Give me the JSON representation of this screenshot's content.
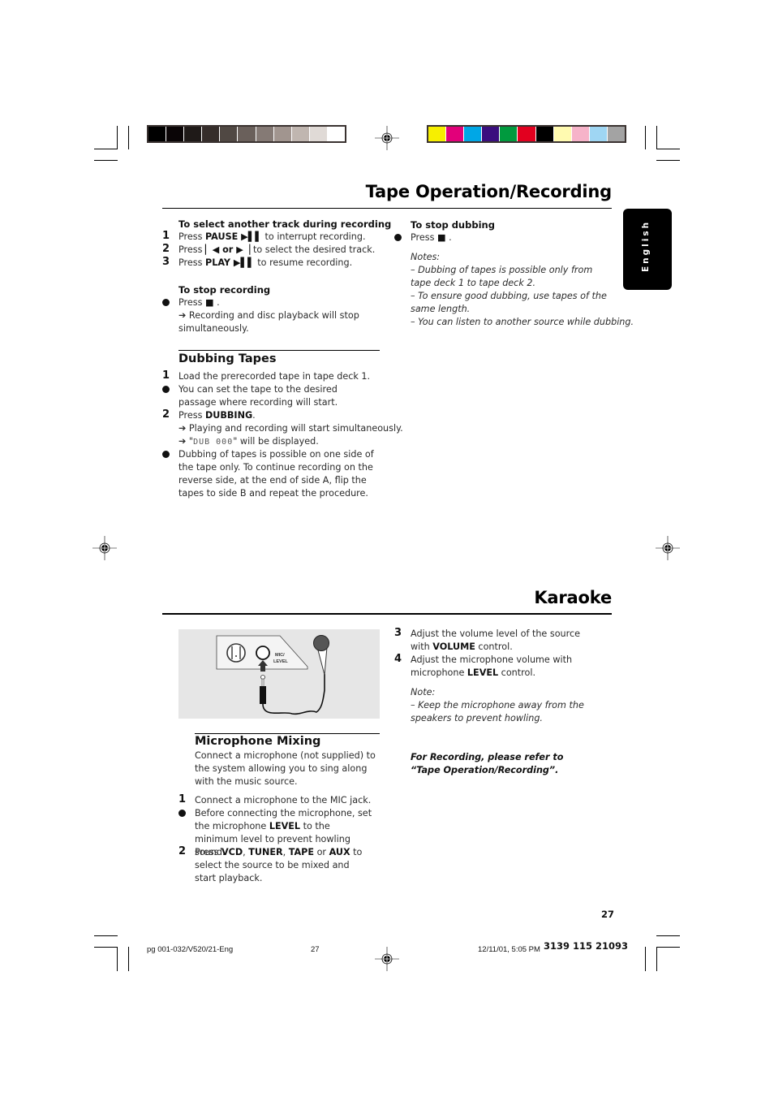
{
  "calibration": {
    "grayscale": [
      "#000000",
      "#0a0506",
      "#1f1a18",
      "#352d2a",
      "#504843",
      "#6a605b",
      "#857a75",
      "#a1958f",
      "#c0b6b0",
      "#e0dad6",
      "#ffffff"
    ],
    "color": [
      "#f7ef00",
      "#e2007a",
      "#00a7e6",
      "#3a0e7e",
      "#009a3e",
      "#e2001f",
      "#000000",
      "#fffab0",
      "#f6b3c9",
      "#9fd6f3",
      "#a3a3a3"
    ]
  },
  "language_tab": "English",
  "section1": {
    "title": "Tape Operation/Recording",
    "select_track": {
      "heading": "To select another track during recording",
      "steps": [
        {
          "num": "1",
          "pre": "Press ",
          "key": "PAUSE ▶▌▌",
          "post": " to interrupt recording."
        },
        {
          "num": "2",
          "pre": "Press ",
          "key": "▏◀ or ▶▕",
          "post": " to select the desired track."
        },
        {
          "num": "3",
          "pre": "Press ",
          "key": "PLAY ▶▌▌",
          "post": " to resume recording."
        }
      ]
    },
    "stop_recording": {
      "heading": "To stop recording",
      "press": "Press",
      "stop_symbol": "■",
      "result": "➔ Recording and disc playback will stop simultaneously."
    },
    "dubbing": {
      "heading": "Dubbing Tapes",
      "step1": "Load the prerecorded tape in tape deck 1.",
      "bullet1": "You can set the tape to the desired passage where recording will start.",
      "step2_pre": "Press ",
      "step2_key": "DUBBING",
      "step2_post": ".",
      "result1": "➔ Playing and recording will start simultaneously.",
      "result2_pre": "➔ \"",
      "result2_lcd": "DUB 000",
      "result2_post": "\" will be displayed.",
      "bullet2": "Dubbing of tapes is possible on one side of the tape only. To continue recording on the reverse side, at the end of side A, flip the tapes to side B and repeat the procedure."
    },
    "stop_dubbing": {
      "heading": "To stop dubbing",
      "press": "Press",
      "stop_symbol": "■",
      "notes_label": "Notes:",
      "notes": [
        "–  Dubbing of tapes is possible only from tape deck 1 to tape deck 2.",
        "–  To ensure good dubbing, use tapes of the same length.",
        "–  You can listen to another source while dubbing."
      ]
    }
  },
  "section2": {
    "title": "Karaoke",
    "illustration": {
      "jack_label_1": "MIC/",
      "jack_label_2": "LEVEL"
    },
    "mic_mixing": {
      "heading": "Microphone Mixing",
      "intro": "Connect a microphone (not supplied) to the system allowing you to sing along with the music source.",
      "step1": "Connect a microphone to the MIC jack.",
      "bullet_pre": "Before connecting the microphone, set the microphone ",
      "bullet_key": "LEVEL",
      "bullet_post": " to the minimum level to prevent howling sound.",
      "step2_pre": "Press ",
      "step2_k1": "VCD",
      "step2_k2": "TUNER",
      "step2_k3": "TAPE",
      "step2_or": " or ",
      "step2_k4": "AUX",
      "step2_post": " to select the source to be mixed and start playback."
    },
    "step3_pre": "Adjust the volume level of the source with ",
    "step3_key": "VOLUME",
    "step3_post": " control.",
    "step4_pre": "Adjust the microphone volume with microphone ",
    "step4_key": "LEVEL",
    "step4_post": " control.",
    "note_label": "Note:",
    "note": "–  Keep the microphone away from the speakers to prevent howling.",
    "reference": "For Recording, please refer to “Tape Operation/Recording”."
  },
  "page_number": "27",
  "footer": {
    "file": "pg 001-032/V520/21-Eng",
    "page": "27",
    "datetime": "12/11/01, 5:05 PM",
    "code": "3139 115 21093"
  }
}
